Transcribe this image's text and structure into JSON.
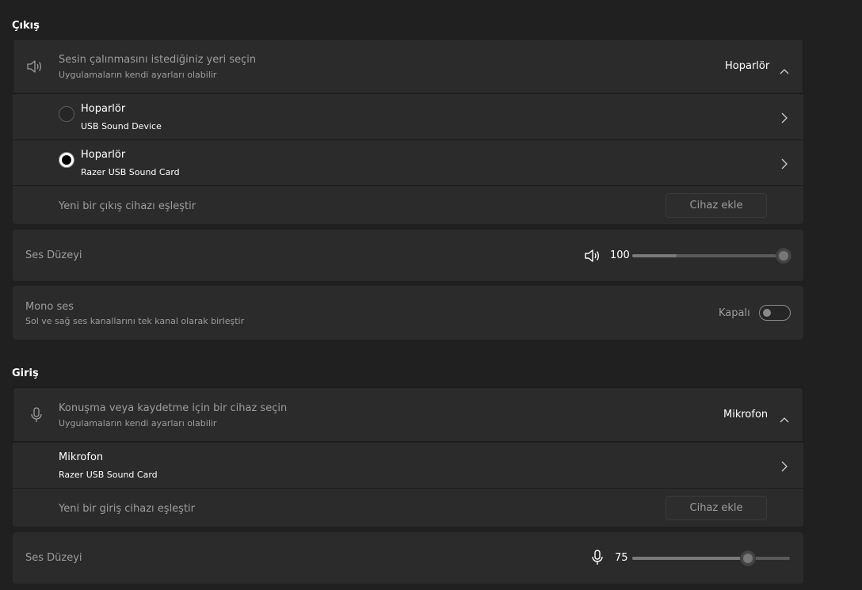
{
  "output": {
    "title": "Çıkış",
    "selector": {
      "label": "Sesin çalınmasını istediğiniz yeri seçin",
      "sublabel": "Uygulamaların kendi ayarları olabilir",
      "selected": "Hoparlör",
      "icon": "speaker-icon"
    },
    "devices": [
      {
        "name": "Hoparlör",
        "detail": "USB Sound Device",
        "selected": false
      },
      {
        "name": "Hoparlör",
        "detail": "Razer USB Sound Card",
        "selected": true
      }
    ],
    "pair": {
      "label": "Yeni bir çıkış cihazı eşleştir",
      "button": "Cihaz ekle"
    },
    "volume": {
      "label": "Ses Düzeyi",
      "value": "100",
      "level": 1.0,
      "icon": "speaker-icon"
    },
    "mono": {
      "label": "Mono ses",
      "sublabel": "Sol ve sağ ses kanallarını tek kanal olarak birleştir",
      "state": "Kapalı"
    }
  },
  "input": {
    "title": "Giriş",
    "selector": {
      "label": "Konuşma veya kaydetme için bir cihaz seçin",
      "sublabel": "Uygulamaların kendi ayarları olabilir",
      "selected": "Mikrofon",
      "icon": "microphone-icon"
    },
    "devices": [
      {
        "name": "Mikrofon",
        "detail": "Razer USB Sound Card"
      }
    ],
    "pair": {
      "label": "Yeni bir giriş cihazı eşleştir",
      "button": "Cihaz ekle"
    },
    "volume": {
      "label": "Ses Düzeyi",
      "value": "75",
      "level": 0.75,
      "icon": "microphone-icon"
    }
  }
}
